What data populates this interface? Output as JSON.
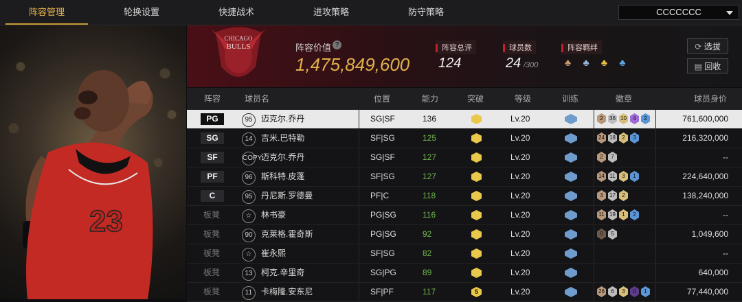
{
  "nav": {
    "tabs": [
      "阵容管理",
      "轮换设置",
      "快捷战术",
      "进攻策略",
      "防守策略"
    ],
    "active_tab": 0,
    "dropdown_value": "CCCCCCC"
  },
  "header": {
    "lineup_value_label": "阵容价值",
    "lineup_value": "1,475,849,600",
    "overall_label": "阵容总评",
    "overall_value": "124",
    "player_count_label": "球员数",
    "player_count": "24",
    "player_count_max": "/300",
    "bond_label": "阵容羁绊",
    "select_btn": "选拔",
    "recycle_btn": "回收"
  },
  "table": {
    "headers": [
      "阵容",
      "球员名",
      "位置",
      "能力",
      "突破",
      "等级",
      "训练",
      "徽章",
      "球员身价"
    ],
    "rows": [
      {
        "slot": "PG",
        "bench": false,
        "num": "95",
        "name": "迈克尔.乔丹",
        "pos": "SG|SF",
        "ability": "136",
        "break": "",
        "level": "Lv.20",
        "badges": [
          {
            "v": "2",
            "c": "#b9977a"
          },
          {
            "v": "36",
            "c": "#bdbdbd"
          },
          {
            "v": "10",
            "c": "#d8bf7a"
          },
          {
            "v": "4",
            "c": "#a06ad6"
          },
          {
            "v": "2",
            "c": "#5b95d6"
          }
        ],
        "value": "761,600,000",
        "selected": true
      },
      {
        "slot": "SG",
        "bench": false,
        "num": "14",
        "name": "吉米.巴特勒",
        "pos": "SF|SG",
        "ability": "125",
        "break": "",
        "level": "Lv.20",
        "badges": [
          {
            "v": "24",
            "c": "#b9977a"
          },
          {
            "v": "18",
            "c": "#bdbdbd"
          },
          {
            "v": "2",
            "c": "#d8bf7a"
          },
          {
            "v": "3",
            "c": "#5b95d6"
          }
        ],
        "value": "216,320,000",
        "selected": false
      },
      {
        "slot": "SF",
        "bench": false,
        "num": "COPY",
        "name": "迈克尔.乔丹",
        "pos": "SG|SF",
        "ability": "127",
        "break": "",
        "level": "Lv.20",
        "badges": [
          {
            "v": "2",
            "c": "#b9977a"
          },
          {
            "v": "7",
            "c": "#bdbdbd"
          }
        ],
        "value": "--",
        "selected": false
      },
      {
        "slot": "PF",
        "bench": false,
        "num": "96",
        "name": "斯科特.皮蓬",
        "pos": "SF|SG",
        "ability": "127",
        "break": "",
        "level": "Lv.20",
        "badges": [
          {
            "v": "14",
            "c": "#b9977a"
          },
          {
            "v": "11",
            "c": "#bdbdbd"
          },
          {
            "v": "3",
            "c": "#d8bf7a"
          },
          {
            "v": "1",
            "c": "#5b95d6"
          }
        ],
        "value": "224,640,000",
        "selected": false
      },
      {
        "slot": "C",
        "bench": false,
        "num": "95",
        "name": "丹尼斯.罗德曼",
        "pos": "PF|C",
        "ability": "118",
        "break": "",
        "level": "Lv.20",
        "badges": [
          {
            "v": "3",
            "c": "#b9977a"
          },
          {
            "v": "17",
            "c": "#bdbdbd"
          },
          {
            "v": "2",
            "c": "#d8bf7a"
          }
        ],
        "value": "138,240,000",
        "selected": false
      },
      {
        "slot": "板凳",
        "bench": true,
        "num": "☆",
        "name": "林书豪",
        "pos": "PG|SG",
        "ability": "116",
        "break": "",
        "level": "Lv.20",
        "badges": [
          {
            "v": "11",
            "c": "#b9977a"
          },
          {
            "v": "19",
            "c": "#bdbdbd"
          },
          {
            "v": "1",
            "c": "#d8bf7a"
          },
          {
            "v": "2",
            "c": "#5b95d6"
          }
        ],
        "value": "--",
        "selected": false
      },
      {
        "slot": "板凳",
        "bench": true,
        "num": "90",
        "name": "克莱格.霍奇斯",
        "pos": "PG|SG",
        "ability": "92",
        "break": "",
        "level": "Lv.20",
        "badges": [
          {
            "v": "0",
            "c": "#6b5a4b"
          },
          {
            "v": "5",
            "c": "#bdbdbd"
          }
        ],
        "value": "1,049,600",
        "selected": false
      },
      {
        "slot": "板凳",
        "bench": true,
        "num": "☆",
        "name": "崔永熙",
        "pos": "SF|SG",
        "ability": "82",
        "break": "",
        "level": "Lv.20",
        "badges": [],
        "value": "--",
        "selected": false
      },
      {
        "slot": "板凳",
        "bench": true,
        "num": "13",
        "name": "柯克.辛里奇",
        "pos": "SG|PG",
        "ability": "89",
        "break": "",
        "level": "Lv.20",
        "badges": [],
        "value": "640,000",
        "selected": false
      },
      {
        "slot": "板凳",
        "bench": true,
        "num": "11",
        "name": "卡梅隆.安东尼",
        "pos": "SF|PF",
        "ability": "117",
        "break": "5",
        "level": "Lv.20",
        "badges": [
          {
            "v": "26",
            "c": "#b9977a"
          },
          {
            "v": "6",
            "c": "#bdbdbd"
          },
          {
            "v": "3",
            "c": "#d8bf7a"
          },
          {
            "v": "0",
            "c": "#5b3d8a"
          },
          {
            "v": "1",
            "c": "#5b95d6"
          }
        ],
        "value": "77,440,000",
        "selected": false
      }
    ]
  }
}
